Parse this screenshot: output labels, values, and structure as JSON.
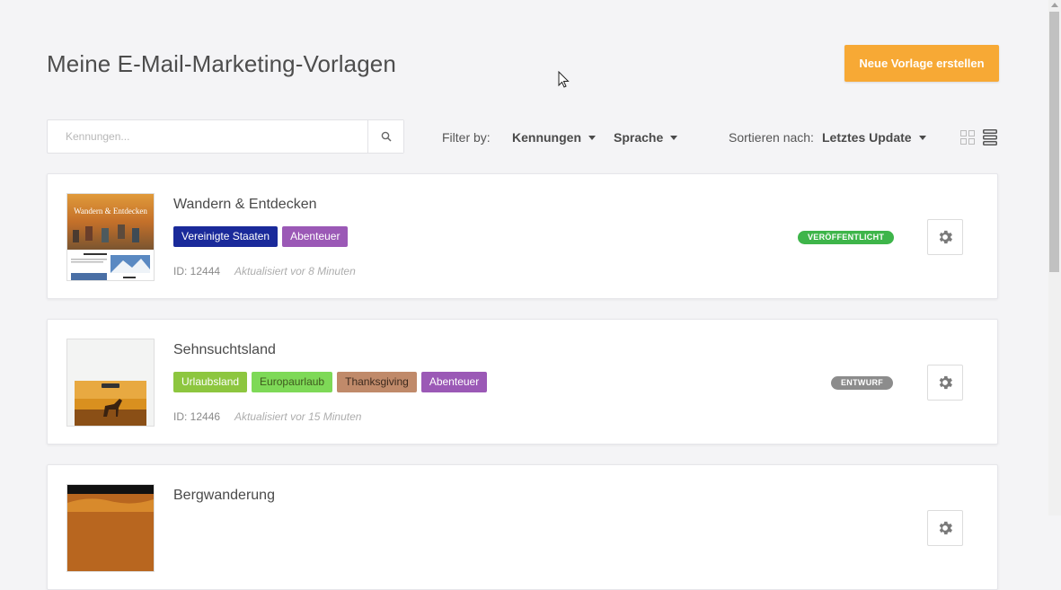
{
  "page": {
    "title": "Meine E-Mail-Marketing-Vorlagen",
    "create_button": "Neue Vorlage erstellen"
  },
  "toolbar": {
    "search_placeholder": "Kennungen...",
    "filter_label": "Filter by:",
    "filter_tags": "Kennungen",
    "filter_language": "Sprache",
    "sort_label": "Sortieren nach:",
    "sort_value": "Letztes Update"
  },
  "colors": {
    "accent": "#f7a935",
    "published": "#3eb54a",
    "draft": "#8c8c8c"
  },
  "templates": [
    {
      "title": "Wandern & Entdecken",
      "tags": [
        {
          "label": "Vereinigte Staaten",
          "color": "#1a2a9a"
        },
        {
          "label": "Abenteuer",
          "color": "#9b59b6"
        }
      ],
      "id": "ID: 12444",
      "updated": "Aktualisiert vor 8 Minuten",
      "status": "VERÖFFENTLICHT",
      "status_color": "#3eb54a",
      "thumb_title": "Wandern & Entdecken"
    },
    {
      "title": "Sehnsuchtsland",
      "tags": [
        {
          "label": "Urlaubsland",
          "color": "#8dc63f"
        },
        {
          "label": "Europaurlaub",
          "color": "#7ed957",
          "text_color": "#3f5a1e"
        },
        {
          "label": "Thanksgiving",
          "color": "#c08a6a",
          "text_color": "#3d2a1e"
        },
        {
          "label": "Abenteuer",
          "color": "#9b59b6"
        }
      ],
      "id": "ID: 12446",
      "updated": "Aktualisiert vor 15 Minuten",
      "status": "ENTWURF",
      "status_color": "#8c8c8c"
    },
    {
      "title": "Bergwanderung"
    }
  ]
}
